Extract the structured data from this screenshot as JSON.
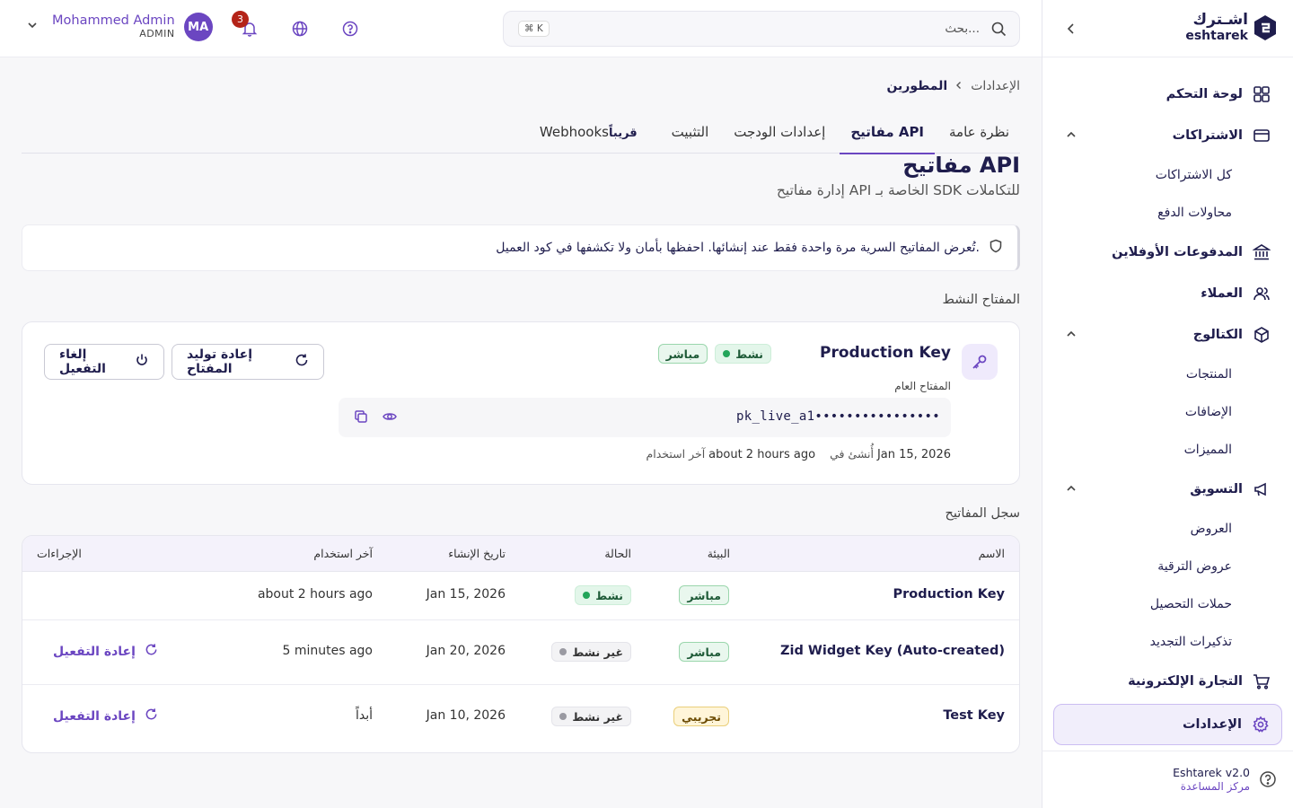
{
  "sidebar": {
    "logo_ar": "اشـترك",
    "logo_en": "eshtarek",
    "nav": {
      "dashboard": "لوحة التحكم",
      "subscriptions": "الاشتراكات",
      "all_subscriptions": "كل الاشتراكات",
      "payment_attempts": "محاولات الدفع",
      "payouts": "المدفوعات الأوفلاين",
      "customers": "العملاء",
      "catalog": "الكتالوج",
      "products": "المنتجات",
      "addons": "الإضافات",
      "features": "المميزات",
      "marketing": "التسويق",
      "offers": "العروض",
      "upgrade_offers": "عروض الترقية",
      "dunning": "حملات التحصيل",
      "renewal_reminders": "تذكيرات التجديد",
      "ecommerce": "التجارة الإلكترونية",
      "settings": "الإعدادات"
    },
    "footer": {
      "version": "Eshtarek v2.0",
      "help_center": "مركز المساعدة"
    }
  },
  "topbar": {
    "search_placeholder": "بحث...",
    "search_shortcut": "⌘ K",
    "notification_count": "3",
    "user_name": "Mohammed Admin",
    "user_role": "ADMIN",
    "avatar_initials": "MA"
  },
  "breadcrumb": {
    "parent": "الإعدادات",
    "current": "المطورين"
  },
  "tabs": {
    "overview": "نظرة عامة",
    "api_keys": "مفاتيح API",
    "widget_settings": "إعدادات الودجت",
    "install": "التثبيت",
    "webhooks": "Webhooks",
    "soon": "قريباً"
  },
  "page": {
    "title": "مفاتيح API",
    "subtitle": "إدارة مفاتيح API الخاصة بـ SDK للتكاملات",
    "notice": "تُعرض المفاتيح السرية مرة واحدة فقط عند إنشائها. احفظها بأمان ولا تكشفها في كود العميل.",
    "active_key_section": "المفتاح النشط",
    "history_section": "سجل المفاتيح"
  },
  "active_key": {
    "name": "Production Key",
    "status": "نشط",
    "environment": "مباشر",
    "public_key_label": "المفتاح العام",
    "public_key_value": "pk_live_a1••••••••••••••••",
    "created_label": "أُنشئ في",
    "created_value": "Jan 15, 2026",
    "last_used_label": "آخر استخدام",
    "last_used_value": "about 2 hours ago",
    "regenerate_button": "إعادة توليد المفتاح",
    "deactivate_button": "إلغاء التفعيل"
  },
  "history_table": {
    "columns": {
      "name": "الاسم",
      "environment": "البيئة",
      "status": "الحالة",
      "created": "تاريخ الإنشاء",
      "last_used": "آخر استخدام",
      "actions": "الإجراءات"
    },
    "rows": [
      {
        "name": "Production Key",
        "environment": "مباشر",
        "status": "نشط",
        "created": "Jan 15, 2026",
        "last_used": "about 2 hours ago",
        "action": ""
      },
      {
        "name": "Zid Widget Key (Auto-created)",
        "environment": "مباشر",
        "status": "غير نشط",
        "created": "Jan 20, 2026",
        "last_used": "5 minutes ago",
        "action": "إعادة التفعيل"
      },
      {
        "name": "Test Key",
        "environment": "تجريبي",
        "status": "غير نشط",
        "created": "Jan 10, 2026",
        "last_used": "أبداً",
        "action": "إعادة التفعيل"
      }
    ]
  },
  "colors": {
    "primary": "#6b46c1",
    "navy": "#1f1d4d",
    "badge_red": "#b42318",
    "active_green": "#23a55a"
  }
}
